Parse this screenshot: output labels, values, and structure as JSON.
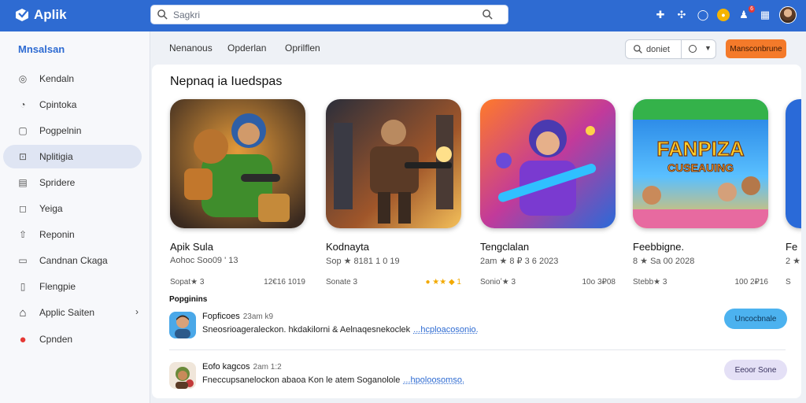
{
  "app": {
    "name": "Aplik",
    "search_placeholder": "Sagkri"
  },
  "topbar": {
    "icons": [
      "puzzle-icon",
      "controller-icon",
      "chat-icon",
      "coin-icon",
      "notification-icon",
      "grid-icon",
      "profile-avatar"
    ],
    "notification_badge": "6"
  },
  "sidebar": {
    "title": "Mnsalsan",
    "items": [
      {
        "label": "Kendaln",
        "icon": "home-icon"
      },
      {
        "label": "Cpintoka",
        "icon": "category-icon"
      },
      {
        "label": "Pogpelnin",
        "icon": "popular-icon"
      },
      {
        "label": "Nplitigia",
        "icon": "apps-icon",
        "active": true
      },
      {
        "label": "Spridere",
        "icon": "list-icon"
      },
      {
        "label": "Yeiga",
        "icon": "bookmark-icon"
      },
      {
        "label": "Reponin",
        "icon": "upload-icon"
      },
      {
        "label": "Candnan Ckaga",
        "icon": "library-icon"
      },
      {
        "label": "Flengpie",
        "icon": "document-icon"
      },
      {
        "label": "Applic Saiten",
        "icon": "store-icon",
        "has_chevron": true
      },
      {
        "label": "Cpnden",
        "icon": "record-icon"
      }
    ]
  },
  "subheader": {
    "tabs": [
      "Nenanous",
      "Opderlan",
      "Oprilflen"
    ],
    "select_value": "doniet",
    "action_label": "Mansconbrune"
  },
  "section": {
    "title": "Nepnaq ia Iuedspas"
  },
  "games": [
    {
      "name": "Apik Sula",
      "meta": "Aohoc Soo09 ' 13",
      "stat_left": "Sopat★ 3",
      "stat_right": "12€16 1019"
    },
    {
      "name": "Kodnayta",
      "meta": "Sop ★ 8181 1 0 19",
      "stat_left": "Sonate 3",
      "stat_right": "● ★★ ◆ 1"
    },
    {
      "name": "Tengclalan",
      "meta": "2am ★ 8 ₽ 3 6 2023",
      "stat_left": "Sonioʼ★ 3",
      "stat_right": "10o 3₽08"
    },
    {
      "name": "Feebbigne.",
      "meta": "8 ★ Sa 00 2028",
      "stat_left": "Stebb★ 3",
      "stat_right": "100 2₽16"
    },
    {
      "name": "Fe",
      "meta": "2 ★",
      "stat_left": "S",
      "stat_right": ""
    }
  ],
  "list": {
    "title": "Popginins",
    "rows": [
      {
        "name": "Fopficoes",
        "time": "23am k9",
        "text": "Sneosrioageraleckon. hkdakilorni & Aelnaqesnekoclek",
        "link": "...hcploacosonio.",
        "button": "Uncocbnale",
        "button_style": "primary"
      },
      {
        "name": "Eofo kagcos",
        "time": "2am 1:2",
        "text": "Fneccupsanelockon abaoa Kon le atem Soganolole",
        "link": "...hpoloosomso.",
        "button": "Eeoor Sone",
        "button_style": "secondary"
      }
    ]
  },
  "colors": {
    "topbar": "#2e6bd2",
    "accent_orange": "#f47a2a",
    "button_blue": "#4cb2ef"
  }
}
